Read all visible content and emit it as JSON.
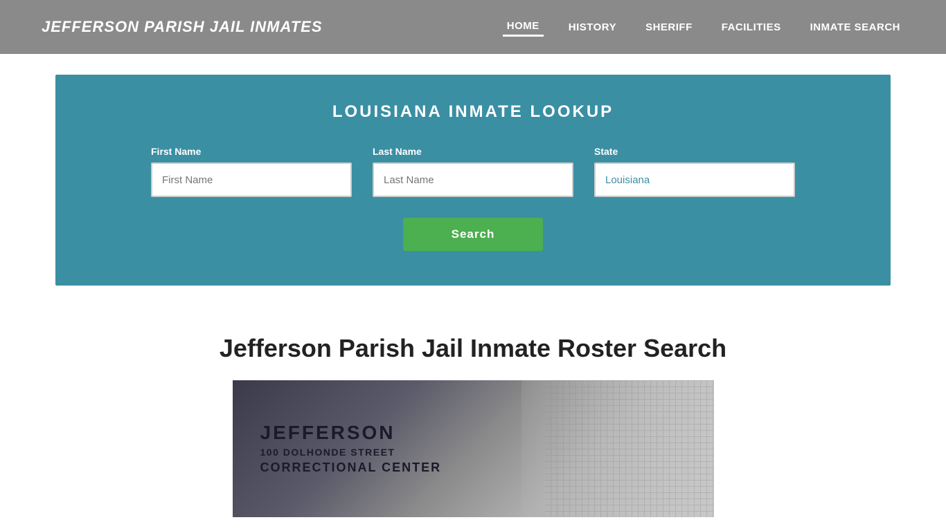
{
  "header": {
    "site_title": "Jefferson Parish Jail Inmates",
    "nav": [
      {
        "label": "HOME",
        "active": true
      },
      {
        "label": "HISTORY",
        "active": false
      },
      {
        "label": "SHERIFF",
        "active": false
      },
      {
        "label": "FACILITIES",
        "active": false
      },
      {
        "label": "INMATE SEARCH",
        "active": false
      }
    ]
  },
  "search": {
    "section_title": "LOUISIANA INMATE LOOKUP",
    "first_name_label": "First Name",
    "first_name_placeholder": "First Name",
    "last_name_label": "Last Name",
    "last_name_placeholder": "Last Name",
    "state_label": "State",
    "state_value": "Louisiana",
    "search_button_label": "Search"
  },
  "roster": {
    "title": "Jefferson Parish Jail Inmate Roster Search",
    "building_line1": "JEFFERSON",
    "building_line2": "100 DOLHONDE STREET",
    "building_line3": "CORRECTIONAL CENTER"
  },
  "colors": {
    "header_bg": "#8a8a8a",
    "search_bg": "#3a8fa3",
    "search_button": "#4caf50",
    "nav_text": "#ffffff",
    "site_title": "#ffffff"
  }
}
